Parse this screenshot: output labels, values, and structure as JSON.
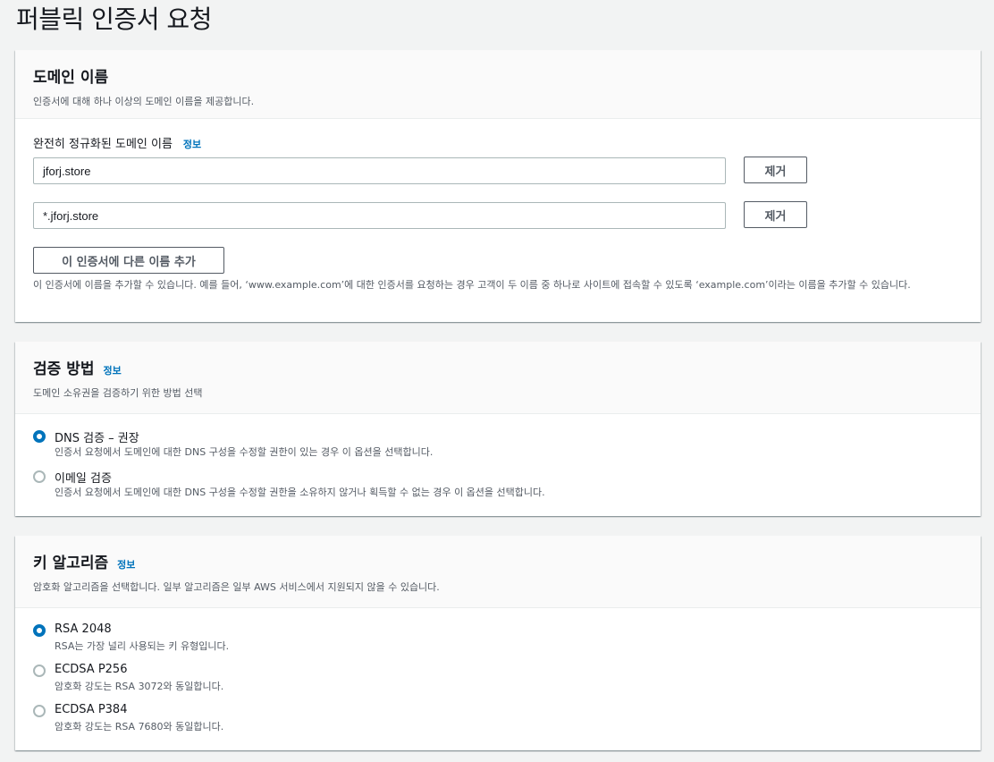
{
  "page": {
    "title": "퍼블릭 인증서 요청"
  },
  "domain_panel": {
    "title": "도메인 이름",
    "description": "인증서에 대해 하나 이상의 도메인 이름을 제공합니다.",
    "field_label": "완전히 정규화된 도메인 이름",
    "info_label": "정보",
    "domains": [
      {
        "value": "jforj.store",
        "remove_label": "제거"
      },
      {
        "value": "*.jforj.store",
        "remove_label": "제거"
      }
    ],
    "add_button_label": "이 인증서에 다른 이름 추가",
    "hint": "이 인증서에 이름을 추가할 수 있습니다. 예를 들어, ‘www.example.com’에 대한 인증서를 요청하는 경우 고객이 두 이름 중 하나로 사이트에 접속할 수 있도록 ‘example.com’이라는 이름을 추가할 수 있습니다."
  },
  "validation_panel": {
    "title": "검증 방법",
    "info_label": "정보",
    "description": "도메인 소유권을 검증하기 위한 방법 선택",
    "options": [
      {
        "label": "DNS 검증 – 권장",
        "description": "인증서 요청에서 도메인에 대한 DNS 구성을 수정할 권한이 있는 경우 이 옵션을 선택합니다.",
        "selected": true
      },
      {
        "label": "이메일 검증",
        "description": "인증서 요청에서 도메인에 대한 DNS 구성을 수정할 권한을 소유하지 않거나 획득할 수 없는 경우 이 옵션을 선택합니다.",
        "selected": false
      }
    ]
  },
  "algorithm_panel": {
    "title": "키 알고리즘",
    "info_label": "정보",
    "description": "암호화 알고리즘을 선택합니다. 일부 알고리즘은 일부 AWS 서비스에서 지원되지 않을 수 있습니다.",
    "options": [
      {
        "label": "RSA 2048",
        "description": "RSA는 가장 널리 사용되는 키 유형입니다.",
        "selected": true
      },
      {
        "label": "ECDSA P256",
        "description": "암호화 강도는 RSA 3072와 동일합니다.",
        "selected": false
      },
      {
        "label": "ECDSA P384",
        "description": "암호화 강도는 RSA 7680와 동일합니다.",
        "selected": false
      }
    ]
  },
  "colors": {
    "accent": "#0073bb",
    "background": "#f2f3f3",
    "panel_header": "#fafafa",
    "text_secondary": "#545b64"
  }
}
